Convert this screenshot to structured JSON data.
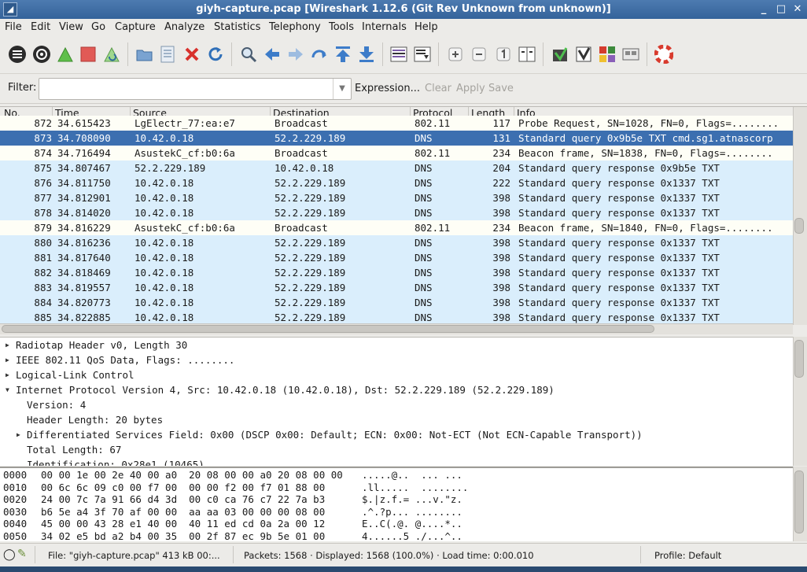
{
  "window": {
    "title": "giyh-capture.pcap  [Wireshark 1.12.6 (Git Rev Unknown from unknown)]",
    "minimize": "_",
    "maximize": "□",
    "close": "✕"
  },
  "menu": [
    "File",
    "Edit",
    "View",
    "Go",
    "Capture",
    "Analyze",
    "Statistics",
    "Telephony",
    "Tools",
    "Internals",
    "Help"
  ],
  "toolbar_icons": [
    "interfaces-icon",
    "options-icon",
    "start-capture-icon",
    "stop-capture-icon",
    "restart-capture-icon",
    "open-file-icon",
    "save-file-icon",
    "close-file-icon",
    "reload-icon",
    "find-icon",
    "back-icon",
    "forward-icon",
    "goto-packet-icon",
    "first-packet-icon",
    "last-packet-icon",
    "colorize-icon",
    "autoscroll-icon",
    "zoom-in-icon",
    "zoom-out-icon",
    "normal-size-icon",
    "resize-columns-icon",
    "capture-filters-icon",
    "display-filters-icon",
    "coloring-rules-icon",
    "preferences-icon",
    "help-icon"
  ],
  "filter": {
    "label": "Filter:",
    "value": "",
    "expression": "Expression...",
    "clear": "Clear",
    "apply": "Apply",
    "save": "Save"
  },
  "packet_list": {
    "columns": [
      "No.",
      "Time",
      "Source",
      "Destination",
      "Protocol",
      "Length",
      "Info"
    ],
    "rows": [
      {
        "no": "872",
        "time": "34.615423",
        "src": "LgElectr_77:ea:e7",
        "dst": "Broadcast",
        "proto": "802.11",
        "len": "117",
        "info": "Probe Request, SN=1028, FN=0, Flags=........",
        "kind": "wlan"
      },
      {
        "no": "873",
        "time": "34.708090",
        "src": "10.42.0.18",
        "dst": "52.2.229.189",
        "proto": "DNS",
        "len": "131",
        "info": "Standard query 0x9b5e  TXT cmd.sg1.atnascorp",
        "kind": "sel"
      },
      {
        "no": "874",
        "time": "34.716494",
        "src": "AsustekC_cf:b0:6a",
        "dst": "Broadcast",
        "proto": "802.11",
        "len": "234",
        "info": "Beacon frame, SN=1838, FN=0, Flags=........",
        "kind": "wlan"
      },
      {
        "no": "875",
        "time": "34.807467",
        "src": "52.2.229.189",
        "dst": "10.42.0.18",
        "proto": "DNS",
        "len": "204",
        "info": "Standard query response 0x9b5e  TXT",
        "kind": "dns"
      },
      {
        "no": "876",
        "time": "34.811750",
        "src": "10.42.0.18",
        "dst": "52.2.229.189",
        "proto": "DNS",
        "len": "222",
        "info": "Standard query response 0x1337  TXT",
        "kind": "dns"
      },
      {
        "no": "877",
        "time": "34.812901",
        "src": "10.42.0.18",
        "dst": "52.2.229.189",
        "proto": "DNS",
        "len": "398",
        "info": "Standard query response 0x1337  TXT",
        "kind": "dns"
      },
      {
        "no": "878",
        "time": "34.814020",
        "src": "10.42.0.18",
        "dst": "52.2.229.189",
        "proto": "DNS",
        "len": "398",
        "info": "Standard query response 0x1337  TXT",
        "kind": "dns"
      },
      {
        "no": "879",
        "time": "34.816229",
        "src": "AsustekC_cf:b0:6a",
        "dst": "Broadcast",
        "proto": "802.11",
        "len": "234",
        "info": "Beacon frame, SN=1840, FN=0, Flags=........",
        "kind": "wlan"
      },
      {
        "no": "880",
        "time": "34.816236",
        "src": "10.42.0.18",
        "dst": "52.2.229.189",
        "proto": "DNS",
        "len": "398",
        "info": "Standard query response 0x1337  TXT",
        "kind": "dns"
      },
      {
        "no": "881",
        "time": "34.817640",
        "src": "10.42.0.18",
        "dst": "52.2.229.189",
        "proto": "DNS",
        "len": "398",
        "info": "Standard query response 0x1337  TXT",
        "kind": "dns"
      },
      {
        "no": "882",
        "time": "34.818469",
        "src": "10.42.0.18",
        "dst": "52.2.229.189",
        "proto": "DNS",
        "len": "398",
        "info": "Standard query response 0x1337  TXT",
        "kind": "dns"
      },
      {
        "no": "883",
        "time": "34.819557",
        "src": "10.42.0.18",
        "dst": "52.2.229.189",
        "proto": "DNS",
        "len": "398",
        "info": "Standard query response 0x1337  TXT",
        "kind": "dns"
      },
      {
        "no": "884",
        "time": "34.820773",
        "src": "10.42.0.18",
        "dst": "52.2.229.189",
        "proto": "DNS",
        "len": "398",
        "info": "Standard query response 0x1337  TXT",
        "kind": "dns"
      },
      {
        "no": "885",
        "time": "34.822885",
        "src": "10.42.0.18",
        "dst": "52.2.229.189",
        "proto": "DNS",
        "len": "398",
        "info": "Standard query response 0x1337  TXT",
        "kind": "dns"
      }
    ]
  },
  "details": [
    {
      "text": "Radiotap Header v0, Length 30",
      "expander": "▶"
    },
    {
      "text": "IEEE 802.11 QoS Data, Flags: ........",
      "expander": "▶"
    },
    {
      "text": "Logical-Link Control",
      "expander": "▶"
    },
    {
      "text": "Internet Protocol Version 4, Src: 10.42.0.18 (10.42.0.18), Dst: 52.2.229.189 (52.2.229.189)",
      "expander": "▼"
    },
    {
      "text": "Version: 4",
      "expander": ""
    },
    {
      "text": "Header Length: 20 bytes",
      "expander": ""
    },
    {
      "text": "Differentiated Services Field: 0x00 (DSCP 0x00: Default; ECN: 0x00: Not-ECT (Not ECN-Capable Transport))",
      "expander": "▶"
    },
    {
      "text": "Total Length: 67",
      "expander": ""
    },
    {
      "text": "Identification: 0x28e1 (10465)",
      "expander": ""
    }
  ],
  "bytes": [
    {
      "offset": "0000",
      "hex": "00 00 1e 00 2e 40 00 a0  20 08 00 00 a0 20 08 00 00",
      "ascii": ".....@..  ... ..."
    },
    {
      "offset": "0010",
      "hex": "00 6c 6c 09 c0 00 f7 00  00 00 f2 00 f7 01 88 00",
      "ascii": ".ll.....  ........"
    },
    {
      "offset": "0020",
      "hex": "24 00 7c 7a 91 66 d4 3d  00 c0 ca 76 c7 22 7a b3",
      "ascii": "$.|z.f.= ...v.\"z."
    },
    {
      "offset": "0030",
      "hex": "b6 5e a4 3f 70 af 00 00  aa aa 03 00 00 00 08 00",
      "ascii": ".^.?p... ........"
    },
    {
      "offset": "0040",
      "hex": "45 00 00 43 28 e1 40 00  40 11 ed cd 0a 2a 00 12",
      "ascii": "E..C(.@. @....*.."
    },
    {
      "offset": "0050",
      "hex": "34 02 e5 bd a2 b4 00 35  00 2f 87 ec 9b 5e 01 00",
      "ascii": "4......5 ./...^.."
    }
  ],
  "status": {
    "file": "File: \"giyh-capture.pcap\" 413 kB 00:...",
    "packets": "Packets: 1568 · Displayed: 1568 (100.0%) · Load time: 0:00.010",
    "profile": "Profile: Default"
  }
}
